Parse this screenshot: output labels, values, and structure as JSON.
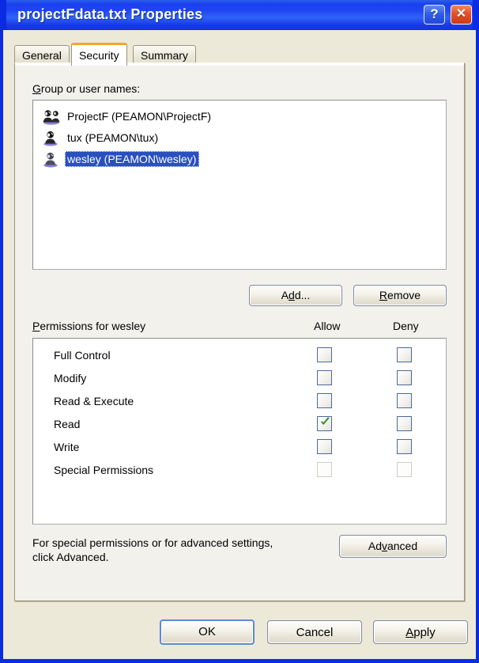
{
  "window": {
    "title": "projectFdata.txt Properties",
    "help_button": "?",
    "close_button": "✕",
    "help_icon_name": "help-icon",
    "close_icon_name": "close-icon"
  },
  "tabs": [
    {
      "label": "General",
      "active": false
    },
    {
      "label": "Security",
      "active": true
    },
    {
      "label": "Summary",
      "active": false
    }
  ],
  "security": {
    "group_label_prefix": "G",
    "group_label_rest": "roup or user names:",
    "group_label": "Group or user names:",
    "users": [
      {
        "name": "ProjectF (PEAMON\\ProjectF)",
        "icon": "group-users-icon",
        "selected": false
      },
      {
        "name": "tux (PEAMON\\tux)",
        "icon": "single-user-icon",
        "selected": false
      },
      {
        "name": "wesley (PEAMON\\wesley)",
        "icon": "single-user-icon",
        "selected": true
      }
    ],
    "add_button": {
      "pre": "A",
      "accel": "d",
      "post": "d...",
      "label": "Add..."
    },
    "remove_button": {
      "accel": "R",
      "post": "emove",
      "label": "Remove"
    },
    "permissions_label_accel": "P",
    "permissions_label_rest": "ermissions for wesley",
    "permissions_label": "Permissions for wesley",
    "allow_column": "Allow",
    "deny_column": "Deny",
    "permissions": [
      {
        "name": "Full Control",
        "allow": false,
        "deny": false,
        "disabled": false
      },
      {
        "name": "Modify",
        "allow": false,
        "deny": false,
        "disabled": false
      },
      {
        "name": "Read & Execute",
        "allow": false,
        "deny": false,
        "disabled": false
      },
      {
        "name": "Read",
        "allow": true,
        "deny": false,
        "disabled": false
      },
      {
        "name": "Write",
        "allow": false,
        "deny": false,
        "disabled": false
      },
      {
        "name": "Special Permissions",
        "allow": false,
        "deny": false,
        "disabled": true
      }
    ],
    "advanced_text_line1": "For special permissions or for advanced settings,",
    "advanced_text_line2": "click Advanced.",
    "advanced_button": {
      "pre": "Ad",
      "accel": "v",
      "post": "anced",
      "label": "Advanced"
    }
  },
  "footer": {
    "ok": "OK",
    "cancel": "Cancel",
    "apply_accel": "A",
    "apply_rest": "pply",
    "apply": "Apply"
  },
  "colors": {
    "titlebar_blue": "#1a3ff0",
    "dialog_face": "#ECE9D8",
    "selection_blue": "#2A4FBF",
    "active_tab_accent": "#F5A623",
    "checkmark_green": "#2a8a2a",
    "close_button_red": "#e2512a"
  }
}
